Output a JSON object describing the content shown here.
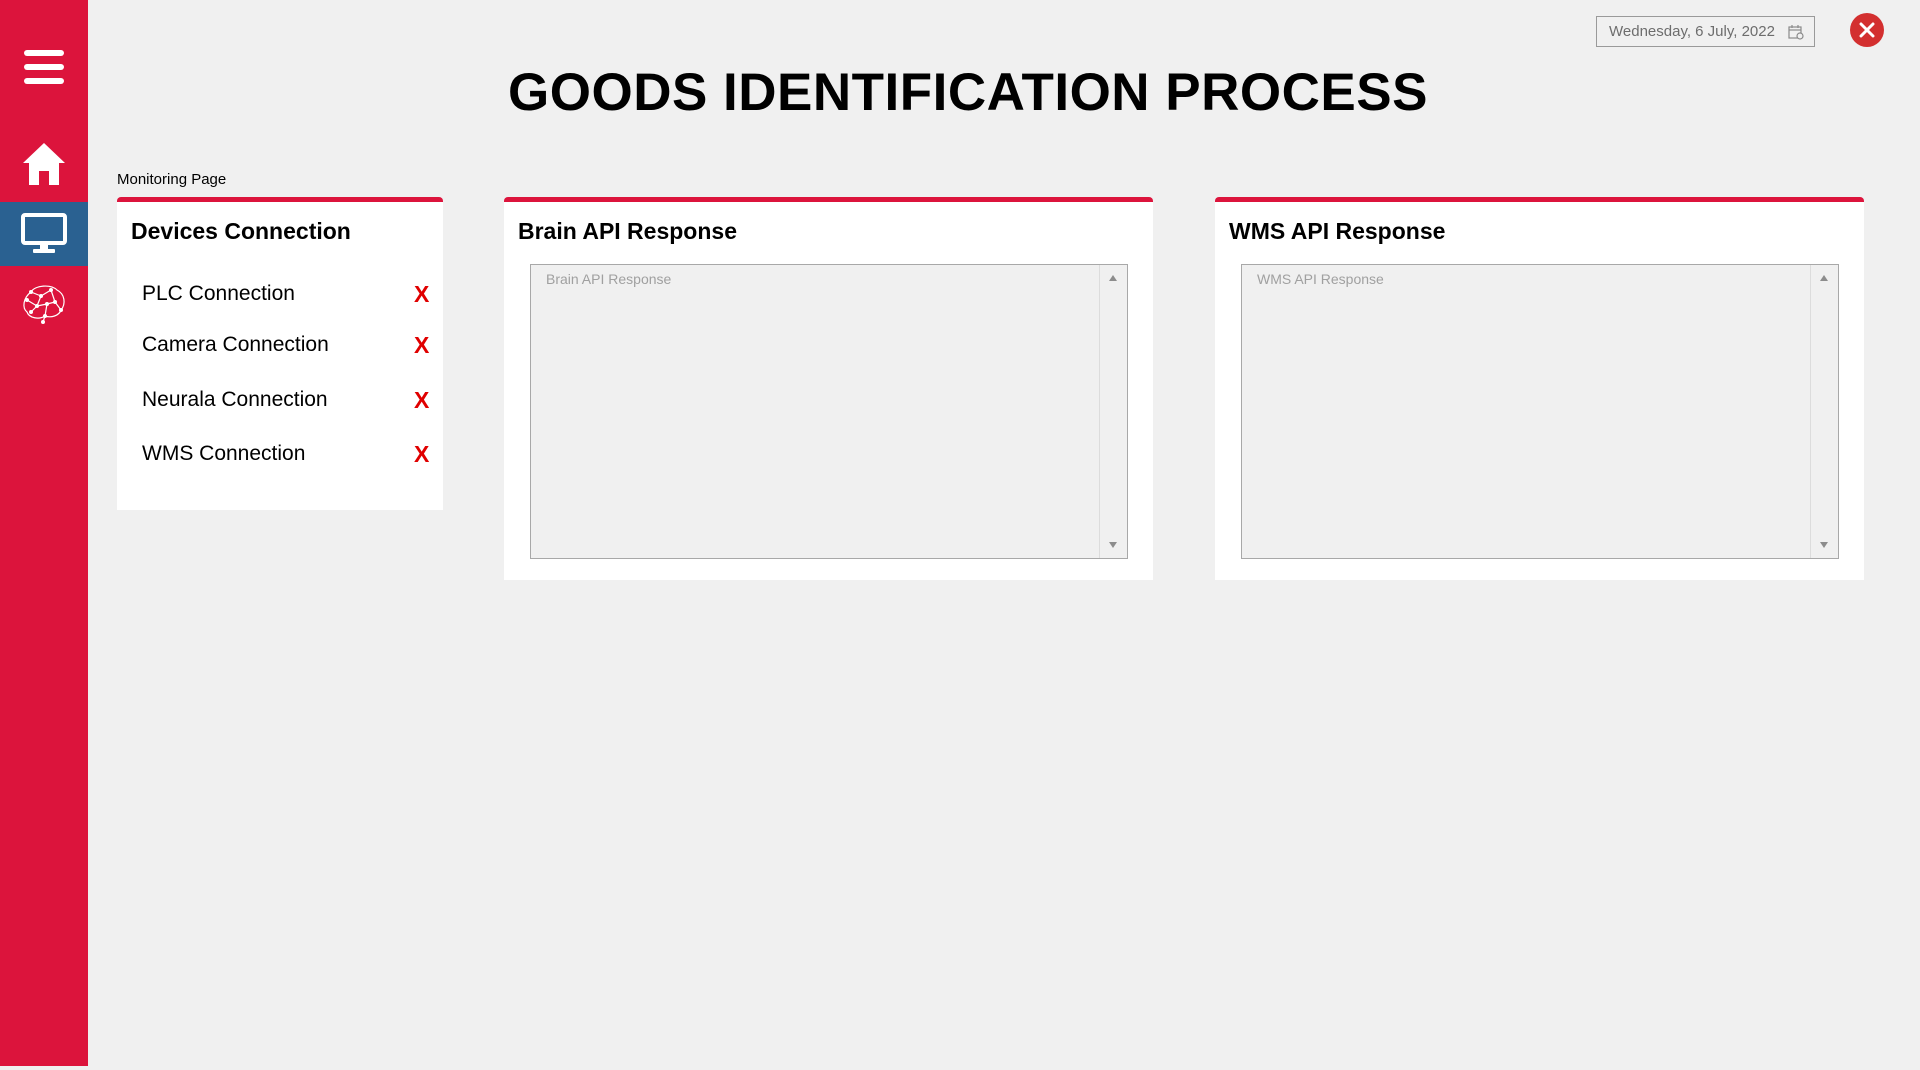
{
  "sidebar": {
    "items": [
      {
        "name": "menu",
        "icon": "hamburger-menu-icon"
      },
      {
        "name": "home",
        "icon": "home-icon"
      },
      {
        "name": "monitoring",
        "icon": "monitor-icon",
        "active": true
      },
      {
        "name": "neural",
        "icon": "neural-brain-icon"
      }
    ],
    "color": "#dc143c",
    "active_color": "#2a6191"
  },
  "header": {
    "date": "Wednesday, 6 July, 2022",
    "title": "GOODS IDENTIFICATION PROCESS"
  },
  "breadcrumb": "Monitoring Page",
  "devices": {
    "title": "Devices Connection",
    "connections": [
      {
        "label": "PLC Connection",
        "status": "X"
      },
      {
        "label": "Camera Connection",
        "status": "X"
      },
      {
        "label": "Neurala Connection",
        "status": "X"
      },
      {
        "label": "WMS Connection",
        "status": "X"
      }
    ],
    "status_color": "#e00000"
  },
  "brain": {
    "title": "Brain API Response",
    "placeholder": "Brain API Response"
  },
  "wms": {
    "title": "WMS API Response",
    "placeholder": "WMS API Response"
  }
}
